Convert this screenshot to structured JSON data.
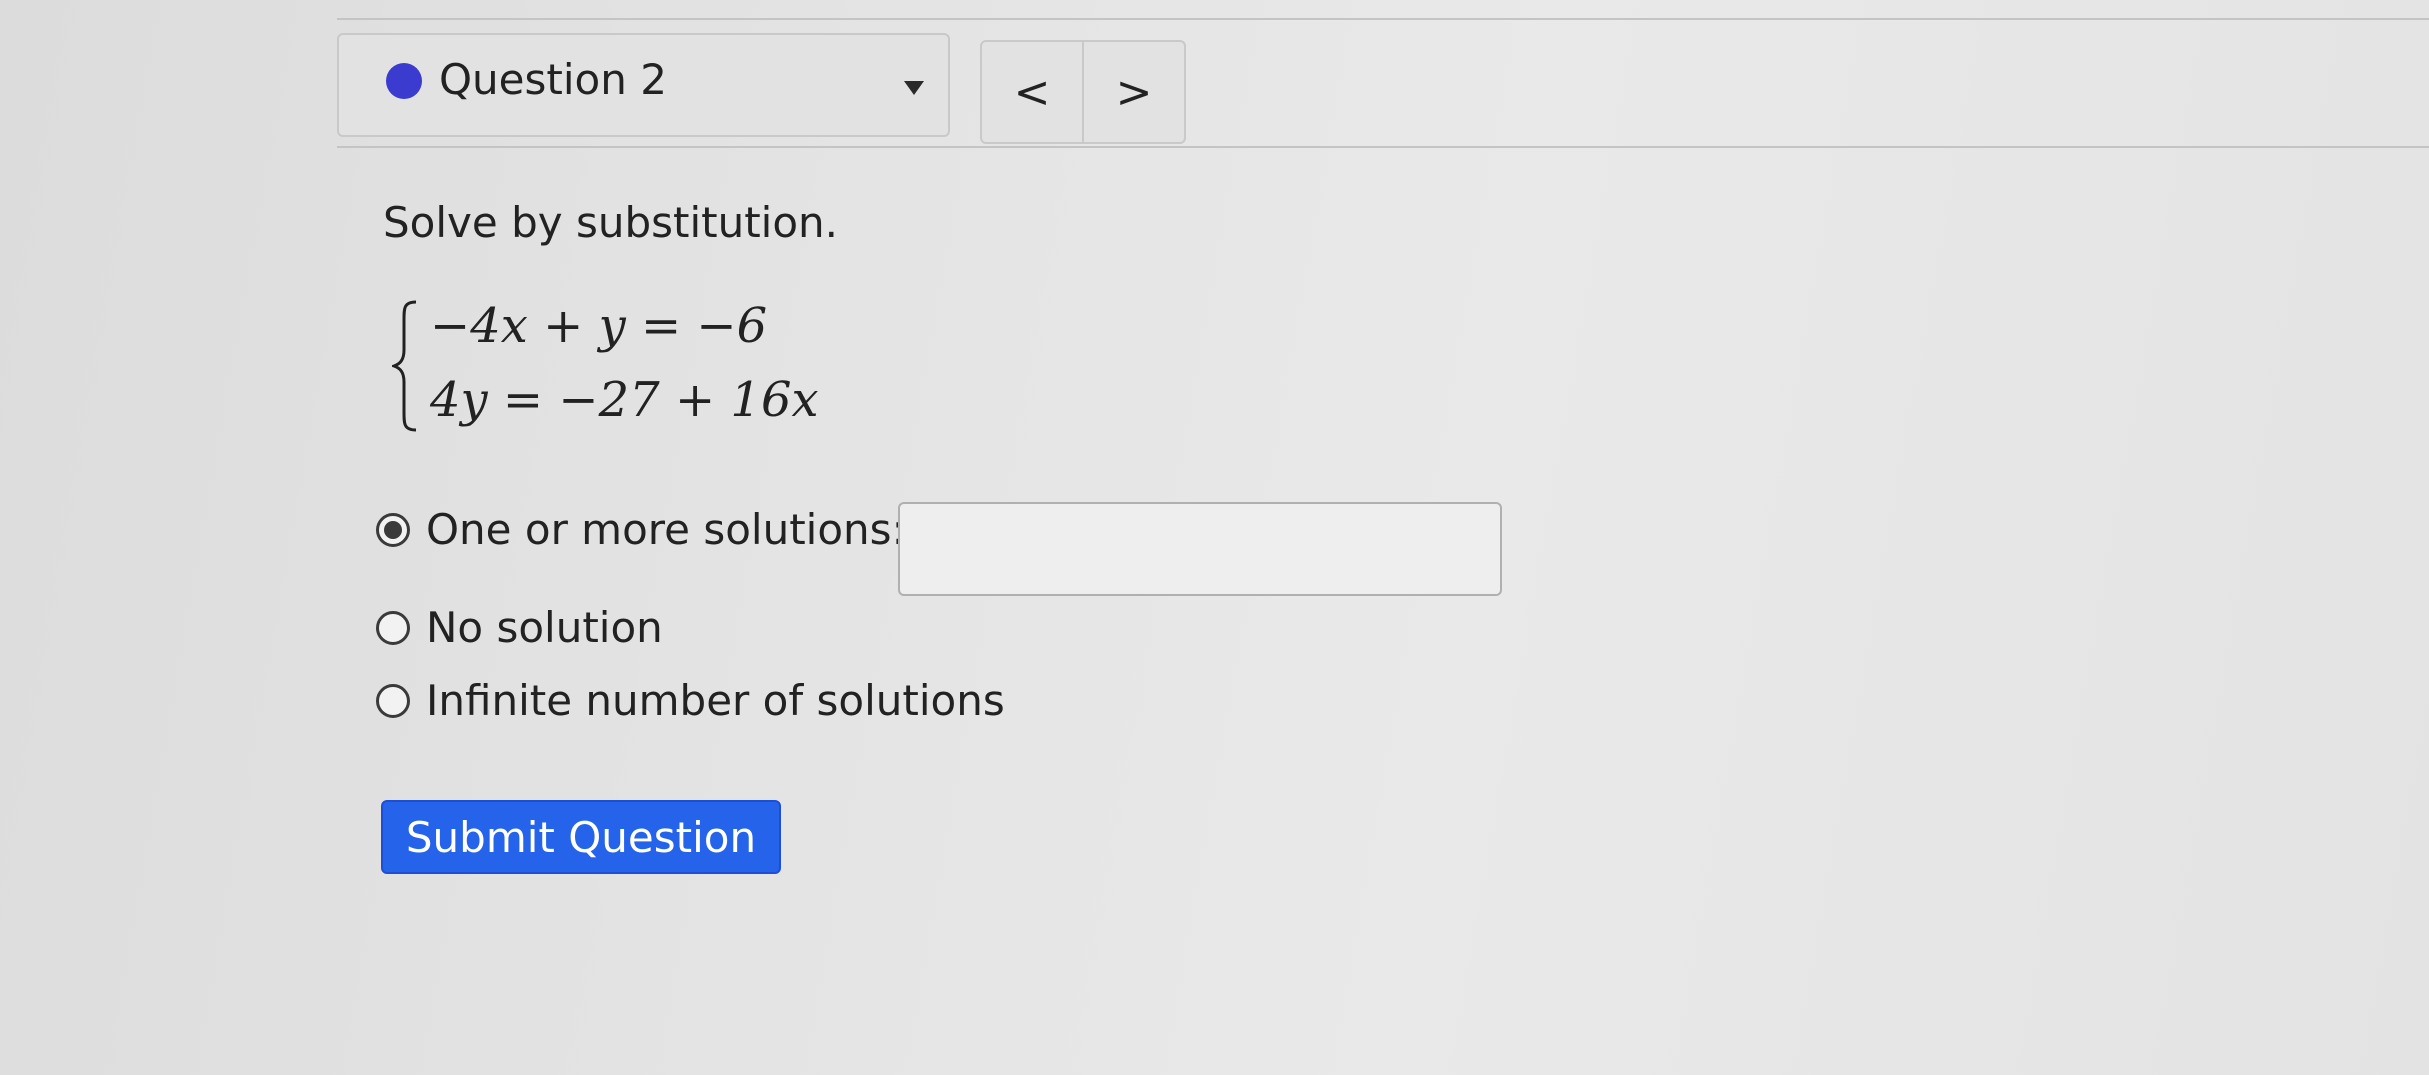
{
  "question_nav": {
    "title": "Question 2",
    "dot_color": "#3b3bd0",
    "dropdown_icon": "caret-down-icon",
    "prev_label": "<",
    "next_label": ">"
  },
  "problem": {
    "prompt": "Solve by substitution.",
    "equations": [
      "−4x + y = −6",
      "4y = −27 + 16x"
    ]
  },
  "answer": {
    "options": [
      {
        "label": "One or more solutions:",
        "selected": true
      },
      {
        "label": "No solution",
        "selected": false
      },
      {
        "label": "Infinite number of solutions",
        "selected": false
      }
    ],
    "input_value": ""
  },
  "actions": {
    "submit_label": "Submit Question",
    "submit_color": "#2563eb"
  }
}
